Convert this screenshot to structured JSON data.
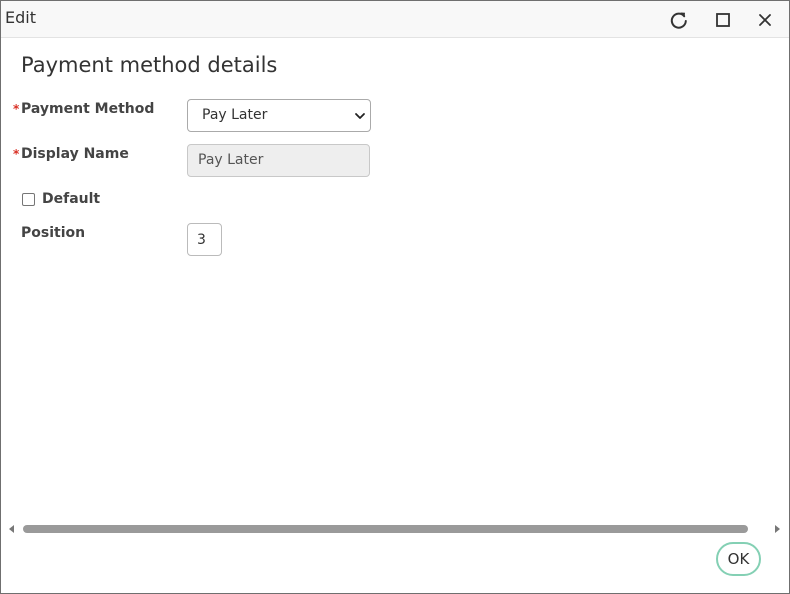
{
  "window": {
    "title": "Edit",
    "controls": {
      "refresh_icon": "refresh-icon",
      "maximize_icon": "maximize-icon",
      "close_icon": "close-icon"
    }
  },
  "form": {
    "heading": "Payment method details",
    "required_marker": "*",
    "payment_method": {
      "label": "Payment Method",
      "value": "Pay Later",
      "required": true
    },
    "display_name": {
      "label": "Display Name",
      "value": "Pay Later",
      "required": true,
      "readonly": true
    },
    "default": {
      "label": "Default",
      "checked": false
    },
    "position": {
      "label": "Position",
      "value": "3"
    }
  },
  "footer": {
    "ok_label": "OK"
  },
  "colors": {
    "accent_border": "#84d0b4",
    "required": "#d93025"
  }
}
